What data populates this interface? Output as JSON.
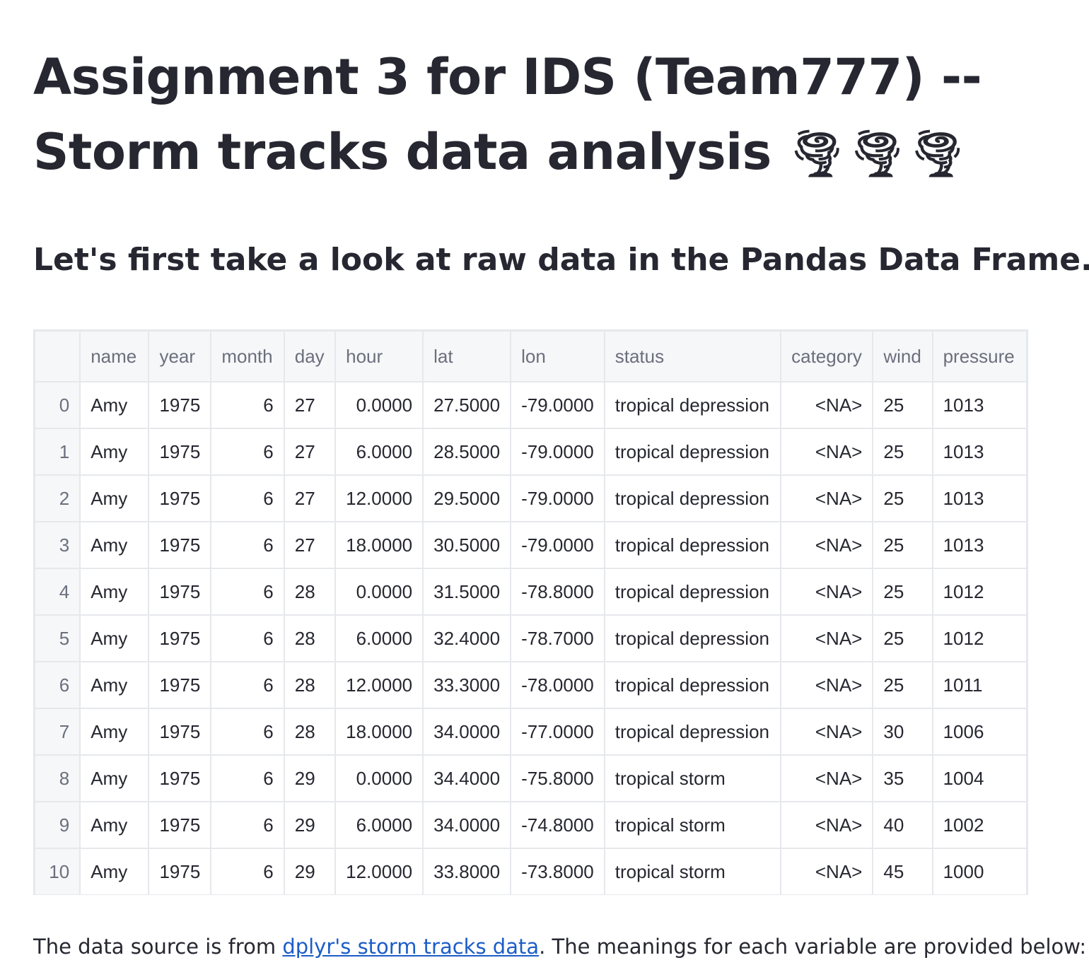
{
  "page": {
    "title": "Assignment 3 for IDS (Team777) --",
    "title_line2": "Storm tracks data analysis",
    "title_emoji": "🌪🌪🌪",
    "subtitle": "Let's first take a look at raw data in the Pandas Data Frame.",
    "footer": {
      "prefix": "The data source is from ",
      "link_text": "dplyr's storm tracks data",
      "suffix": ". The meanings for each variable are provided below:"
    }
  },
  "table": {
    "columns": [
      "name",
      "year",
      "month",
      "day",
      "hour",
      "lat",
      "lon",
      "status",
      "category",
      "wind",
      "pressure"
    ],
    "rows": [
      {
        "idx": "0",
        "cells": [
          "Amy",
          "1975",
          "6",
          "27",
          "0.0000",
          "27.5000",
          "-79.0000",
          "tropical depression",
          "<NA>",
          "25",
          "1013"
        ]
      },
      {
        "idx": "1",
        "cells": [
          "Amy",
          "1975",
          "6",
          "27",
          "6.0000",
          "28.5000",
          "-79.0000",
          "tropical depression",
          "<NA>",
          "25",
          "1013"
        ]
      },
      {
        "idx": "2",
        "cells": [
          "Amy",
          "1975",
          "6",
          "27",
          "12.0000",
          "29.5000",
          "-79.0000",
          "tropical depression",
          "<NA>",
          "25",
          "1013"
        ]
      },
      {
        "idx": "3",
        "cells": [
          "Amy",
          "1975",
          "6",
          "27",
          "18.0000",
          "30.5000",
          "-79.0000",
          "tropical depression",
          "<NA>",
          "25",
          "1013"
        ]
      },
      {
        "idx": "4",
        "cells": [
          "Amy",
          "1975",
          "6",
          "28",
          "0.0000",
          "31.5000",
          "-78.8000",
          "tropical depression",
          "<NA>",
          "25",
          "1012"
        ]
      },
      {
        "idx": "5",
        "cells": [
          "Amy",
          "1975",
          "6",
          "28",
          "6.0000",
          "32.4000",
          "-78.7000",
          "tropical depression",
          "<NA>",
          "25",
          "1012"
        ]
      },
      {
        "idx": "6",
        "cells": [
          "Amy",
          "1975",
          "6",
          "28",
          "12.0000",
          "33.3000",
          "-78.0000",
          "tropical depression",
          "<NA>",
          "25",
          "1011"
        ]
      },
      {
        "idx": "7",
        "cells": [
          "Amy",
          "1975",
          "6",
          "28",
          "18.0000",
          "34.0000",
          "-77.0000",
          "tropical depression",
          "<NA>",
          "30",
          "1006"
        ]
      },
      {
        "idx": "8",
        "cells": [
          "Amy",
          "1975",
          "6",
          "29",
          "0.0000",
          "34.4000",
          "-75.8000",
          "tropical storm",
          "<NA>",
          "35",
          "1004"
        ]
      },
      {
        "idx": "9",
        "cells": [
          "Amy",
          "1975",
          "6",
          "29",
          "6.0000",
          "34.0000",
          "-74.8000",
          "tropical storm",
          "<NA>",
          "40",
          "1002"
        ]
      },
      {
        "idx": "10",
        "cells": [
          "Amy",
          "1975",
          "6",
          "29",
          "12.0000",
          "33.8000",
          "-73.8000",
          "tropical storm",
          "<NA>",
          "45",
          "1000"
        ]
      }
    ]
  }
}
